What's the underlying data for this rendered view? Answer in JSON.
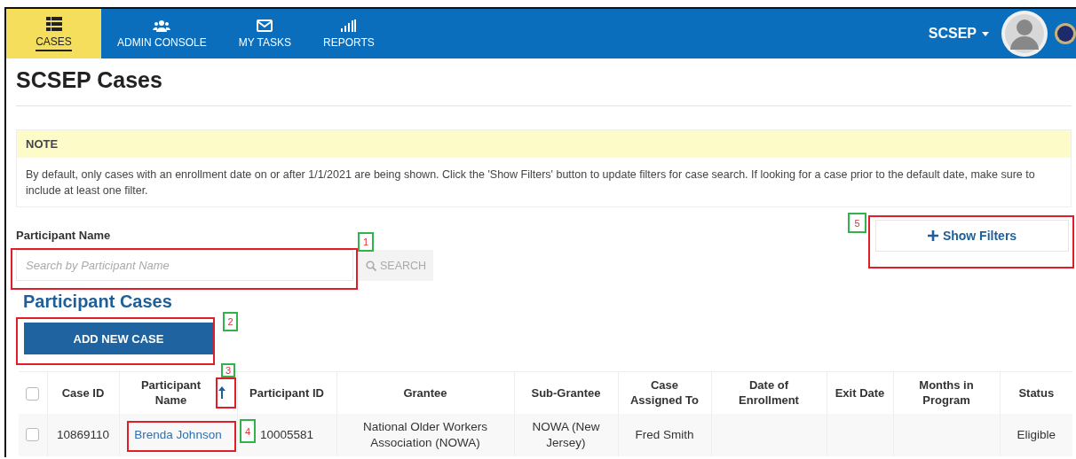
{
  "nav": {
    "tabs": [
      {
        "label": "CASES",
        "selected": true
      },
      {
        "label": "ADMIN CONSOLE",
        "selected": false
      },
      {
        "label": "MY TASKS",
        "selected": false
      },
      {
        "label": "REPORTS",
        "selected": false
      }
    ],
    "user_menu": "SCSEP"
  },
  "page_title": "SCSEP Cases",
  "note": {
    "title": "NOTE",
    "text": "By default, only cases with an enrollment date on or after 1/1/2021 are being shown. Click the 'Show Filters' button to update filters for case search. If looking for a case prior to the default date, make sure to include at least one filter."
  },
  "show_filters_button": "Show Filters",
  "search": {
    "label": "Participant Name",
    "placeholder": "Search by Participant Name",
    "button": "SEARCH"
  },
  "section_title": "Participant Cases",
  "add_button": "ADD NEW CASE",
  "table": {
    "columns": [
      {
        "label": "Case ID",
        "sorted": false
      },
      {
        "label": "Participant Name",
        "sorted": true
      },
      {
        "label": "Participant ID",
        "sorted": false
      },
      {
        "label": "Grantee",
        "sorted": false
      },
      {
        "label": "Sub-Grantee",
        "sorted": false
      },
      {
        "label": "Case Assigned To",
        "sorted": false
      },
      {
        "label": "Date of Enrollment",
        "sorted": false
      },
      {
        "label": "Exit Date",
        "sorted": false
      },
      {
        "label": "Months in Program",
        "sorted": false
      },
      {
        "label": "Status",
        "sorted": false
      }
    ],
    "header_checked": false,
    "rows": [
      {
        "checked": false,
        "cells": [
          "10869110",
          "Brenda Johnson",
          "10005581",
          "National Older Workers Association (NOWA)",
          "NOWA (New Jersey)",
          "Fred Smith",
          "",
          "",
          "",
          "Eligible"
        ]
      }
    ]
  },
  "annotations": [
    {
      "number": "1"
    },
    {
      "number": "2"
    },
    {
      "number": "3"
    },
    {
      "number": "4"
    },
    {
      "number": "5"
    }
  ]
}
